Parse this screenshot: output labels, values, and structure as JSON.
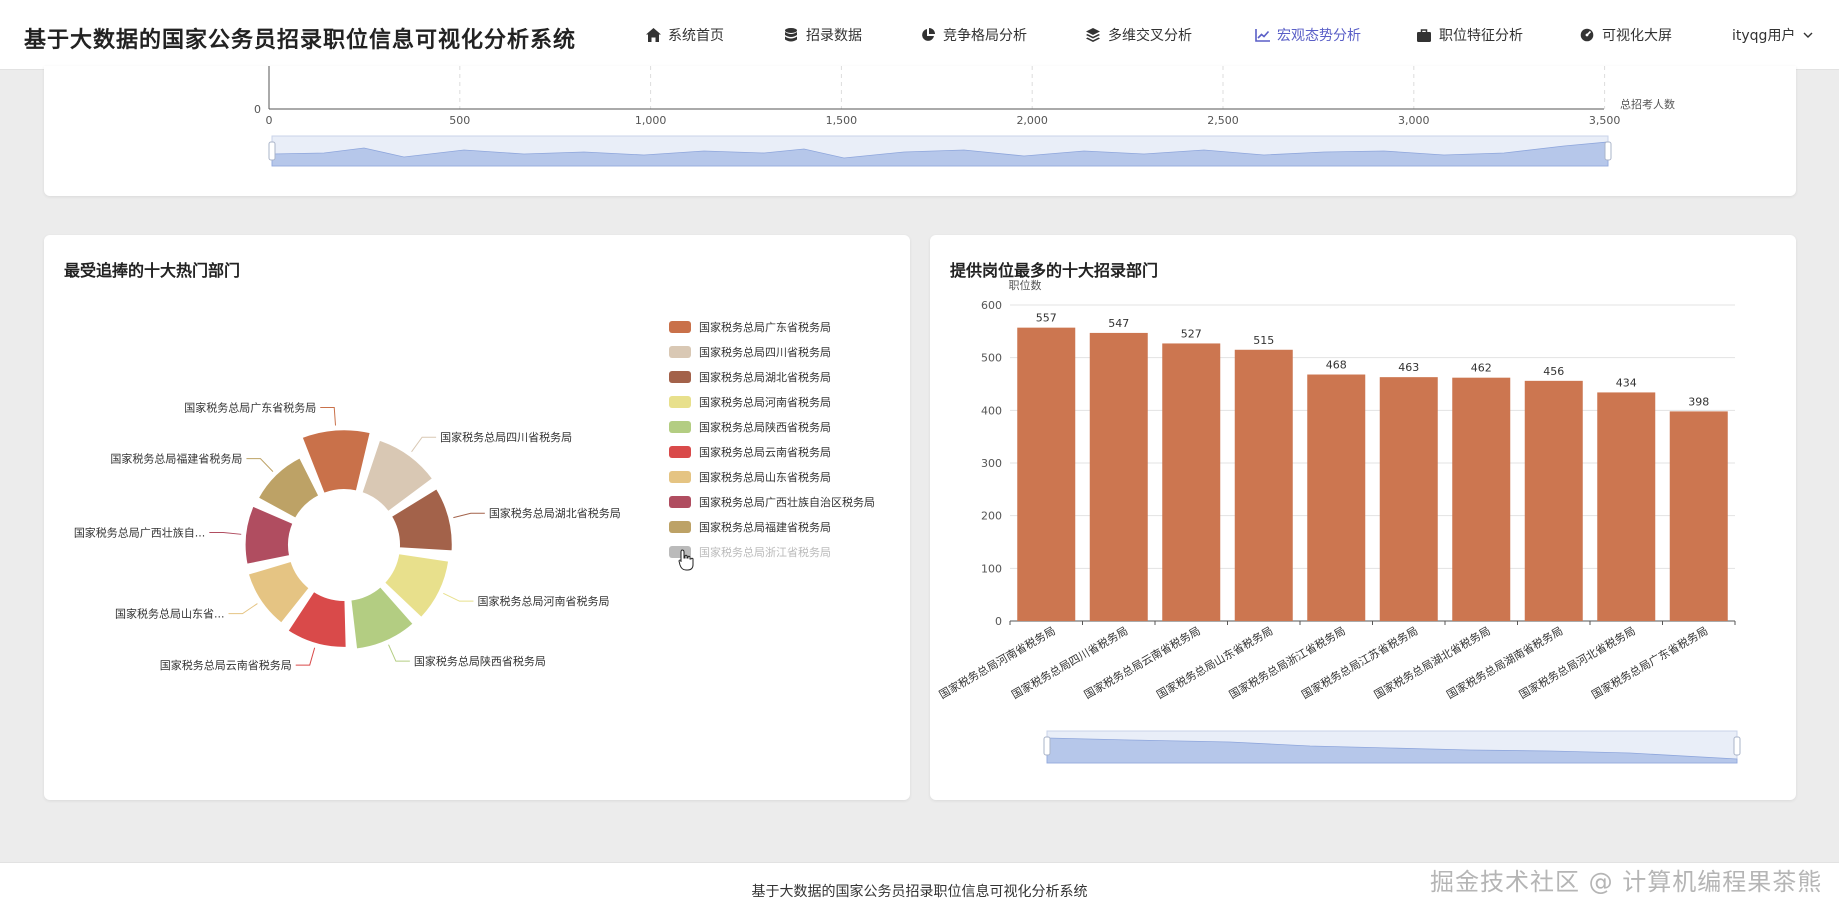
{
  "header": {
    "title": "基于大数据的国家公务员招录职位信息可视化分析系统",
    "nav": [
      {
        "label": "系统首页",
        "icon": "home-icon"
      },
      {
        "label": "招录数据",
        "icon": "database-icon"
      },
      {
        "label": "竞争格局分析",
        "icon": "pie-chart-icon"
      },
      {
        "label": "多维交叉分析",
        "icon": "layers-icon"
      },
      {
        "label": "宏观态势分析",
        "icon": "line-chart-icon",
        "active": true
      },
      {
        "label": "职位特征分析",
        "icon": "briefcase-icon"
      },
      {
        "label": "可视化大屏",
        "icon": "dashboard-icon"
      }
    ],
    "user": "ityqg用户",
    "accent_color": "#5a5fc7"
  },
  "top_chart": {
    "x_ticks": [
      "0",
      "500",
      "1,000",
      "1,500",
      "2,000",
      "2,500",
      "3,000",
      "3,500"
    ],
    "y_tick": "0",
    "x_axis_name": "总招考人数"
  },
  "left_card": {
    "title": "最受追捧的十大热门部门"
  },
  "right_card": {
    "title": "提供岗位最多的十大招录部门"
  },
  "footer": {
    "text": "基于大数据的国家公务员招录职位信息可视化分析系统"
  },
  "watermark": "掘金技术社区 @ 计算机编程果茶熊",
  "chart_data": [
    {
      "type": "pie",
      "subtype": "nightingale-rose",
      "legend_position": "right",
      "categories": [
        "国家税务总局广东省税务局",
        "国家税务总局四川省税务局",
        "国家税务总局湖北省税务局",
        "国家税务总局河南省税务局",
        "国家税务总局陕西省税务局",
        "国家税务总局云南省税务局",
        "国家税务总局山东省税务局",
        "国家税务总局广西壮族自治区税务局",
        "国家税务总局福建省税务局",
        "国家税务总局浙江省税务局"
      ],
      "slice_labels": [
        "国家税务总局广东省税务局",
        "国家税务总局四川省税务局",
        "国家税务总局湖北省税务局",
        "国家税务总局河南省税务局",
        "国家税务总局陕西省税务局",
        "国家税务总局云南省税务局",
        "国家税务总局山东省...",
        "国家税务总局广西壮族自...",
        "国家税务总局福建省税务局"
      ],
      "values": [
        100,
        92,
        88,
        84,
        82,
        78,
        74,
        72,
        70
      ],
      "colors": [
        "#c9714a",
        "#d9c8b4",
        "#a3624a",
        "#e8e08c",
        "#b3cd82",
        "#d94a4a",
        "#e5c483",
        "#b04d60",
        "#bda266",
        "#bbbbbb"
      ],
      "hidden": [
        "国家税务总局浙江省税务局"
      ]
    },
    {
      "type": "bar",
      "categories": [
        "国家税务总局河南省税务局",
        "国家税务总局四川省税务局",
        "国家税务总局云南省税务局",
        "国家税务总局山东省税务局",
        "国家税务总局浙江省税务局",
        "国家税务总局江苏省税务局",
        "国家税务总局湖北省税务局",
        "国家税务总局湖南省税务局",
        "国家税务总局河北省税务局",
        "国家税务总局广东省税务局"
      ],
      "values": [
        557,
        547,
        527,
        515,
        468,
        463,
        462,
        456,
        434,
        398
      ],
      "ylabel": "职位数",
      "ylim": [
        0,
        600
      ],
      "yticks": [
        0,
        100,
        200,
        300,
        400,
        500,
        600
      ],
      "bar_color": "#cc7650",
      "grid": true
    }
  ]
}
